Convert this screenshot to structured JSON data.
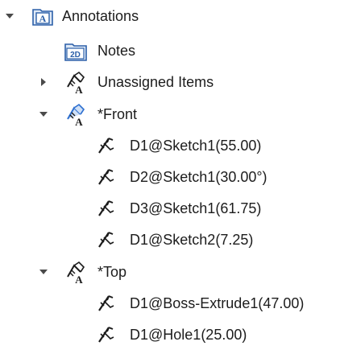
{
  "tree": {
    "root": {
      "label": "Annotations",
      "expanded": true,
      "icon": "annotations-folder-icon"
    },
    "notes": {
      "label": "Notes",
      "icon": "notes-2d-icon",
      "icon_text": "2D"
    },
    "unassigned": {
      "label": "Unassigned Items",
      "expanded": false,
      "icon": "annotation-view-icon"
    },
    "front": {
      "label": "*Front",
      "expanded": true,
      "icon": "annotation-view-active-icon",
      "items": [
        {
          "label": "D1@Sketch1(55.00)",
          "icon": "dimension-icon"
        },
        {
          "label": "D2@Sketch1(30.00°)",
          "icon": "dimension-icon"
        },
        {
          "label": "D3@Sketch1(61.75)",
          "icon": "dimension-icon"
        },
        {
          "label": "D1@Sketch2(7.25)",
          "icon": "dimension-icon"
        }
      ]
    },
    "top": {
      "label": "*Top",
      "expanded": true,
      "icon": "annotation-view-icon",
      "items": [
        {
          "label": "D1@Boss-Extrude1(47.00)",
          "icon": "dimension-icon"
        },
        {
          "label": "D1@Hole1(25.00)",
          "icon": "dimension-icon"
        }
      ]
    }
  },
  "colors": {
    "folder_blue": "#2b5fa8",
    "folder_fill": "#dfe9f6",
    "expander_gray": "#4a4a4a",
    "icon_dark": "#1b1b1b",
    "icon_blue": "#2d6fd0"
  }
}
